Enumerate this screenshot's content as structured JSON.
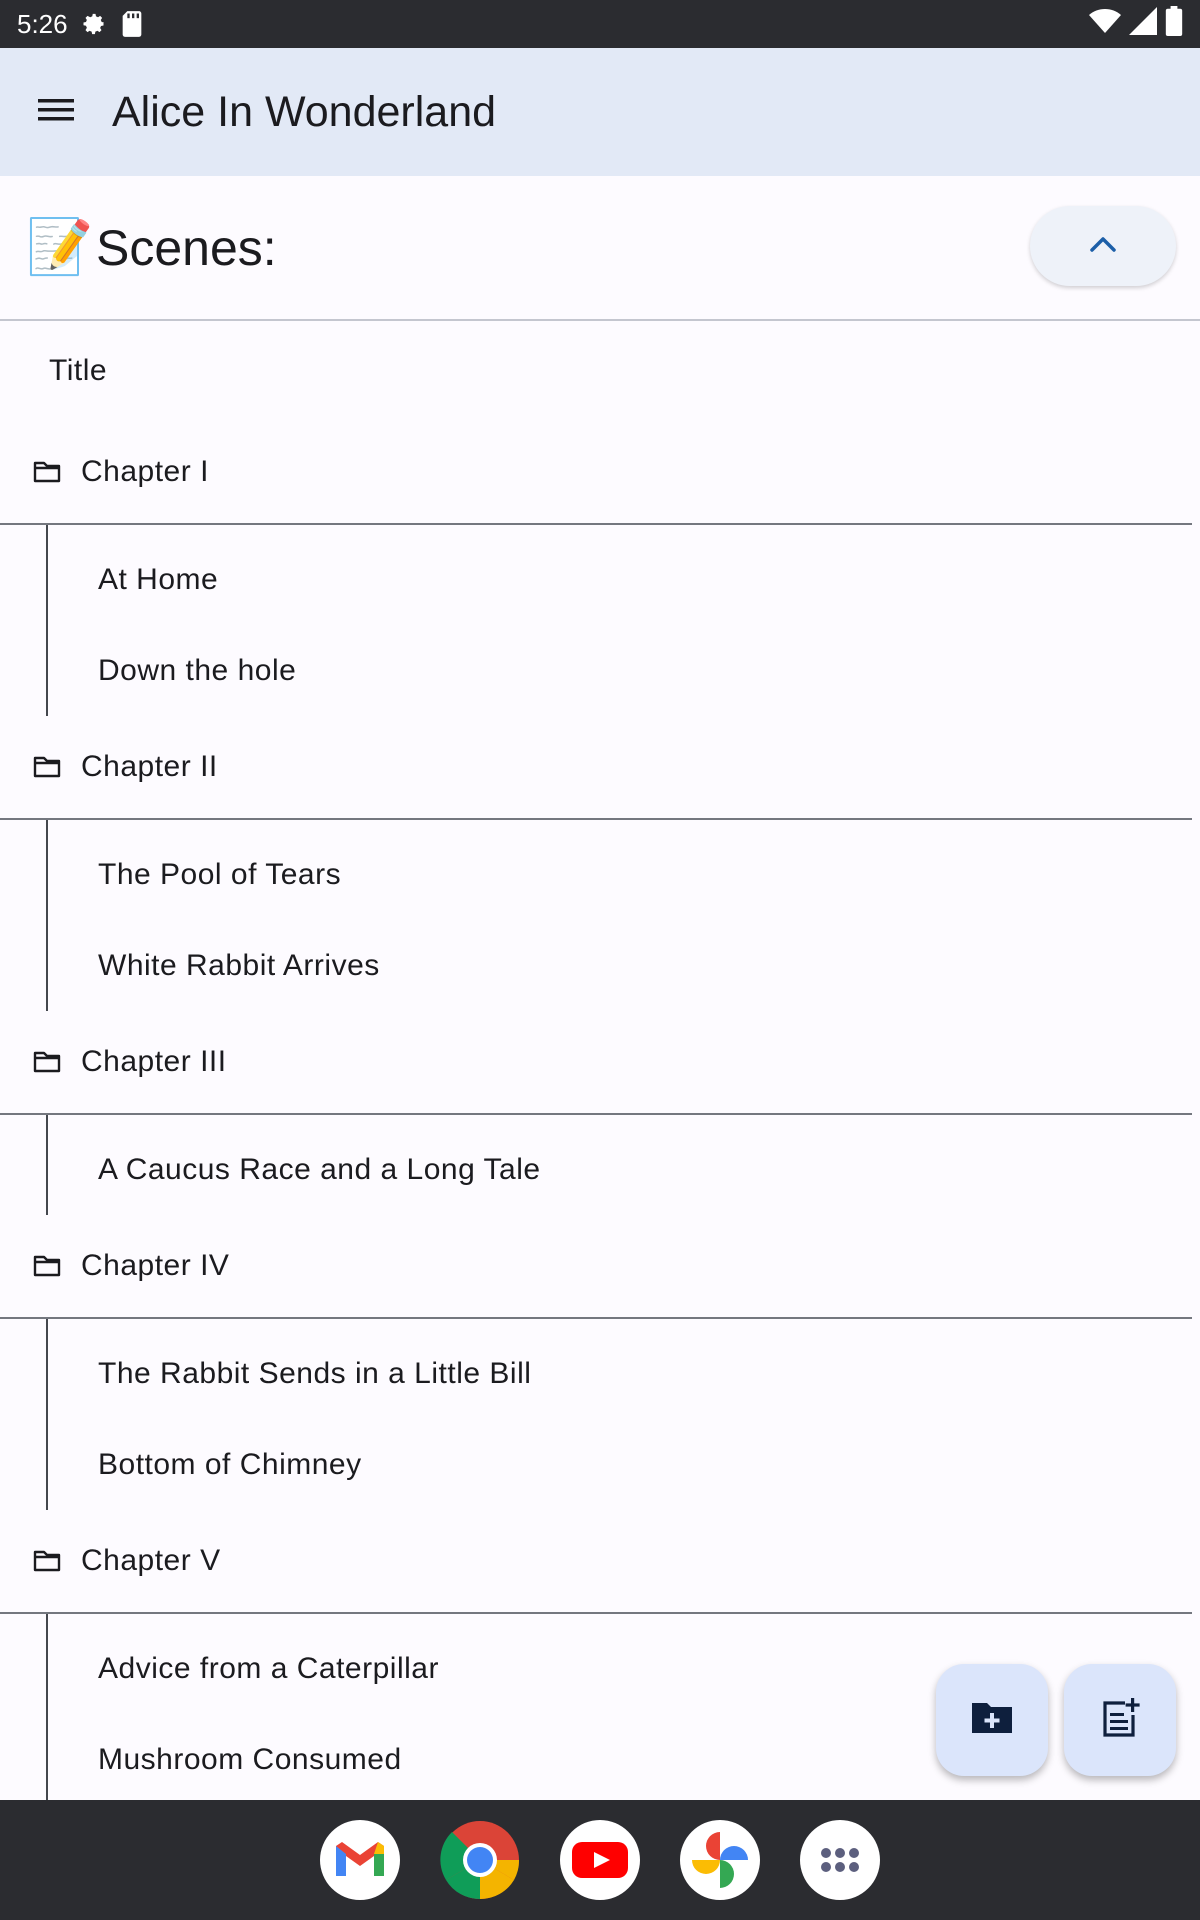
{
  "status_bar": {
    "time": "5:26"
  },
  "app_bar": {
    "title": "Alice In Wonderland"
  },
  "scenes_header": {
    "emoji": "📝",
    "label": "Scenes:"
  },
  "list": {
    "title_item": "Title",
    "chapters": [
      {
        "name": "Chapter I",
        "scenes": [
          "At Home",
          "Down the hole"
        ]
      },
      {
        "name": "Chapter II",
        "scenes": [
          "The Pool of Tears",
          "White Rabbit Arrives"
        ]
      },
      {
        "name": "Chapter III",
        "scenes": [
          "A Caucus Race and a Long Tale"
        ]
      },
      {
        "name": "Chapter IV",
        "scenes": [
          "The Rabbit Sends in a Little Bill",
          "Bottom of Chimney"
        ]
      },
      {
        "name": "Chapter V",
        "scenes": [
          "Advice from a Caterpillar",
          "Mushroom Consumed"
        ]
      }
    ]
  },
  "fabs": {
    "new_folder_icon": "create-new-folder-icon",
    "new_scene_icon": "post-add-icon"
  },
  "dock": {
    "apps": [
      "gmail-icon",
      "chrome-icon",
      "youtube-icon",
      "photos-icon",
      "app-drawer-icon"
    ]
  },
  "colors": {
    "app_bar_bg": "#e2e9f6",
    "fab_bg": "#dbe5fb",
    "system_bar": "#2b2c30",
    "accent": "#1c5fa8"
  }
}
